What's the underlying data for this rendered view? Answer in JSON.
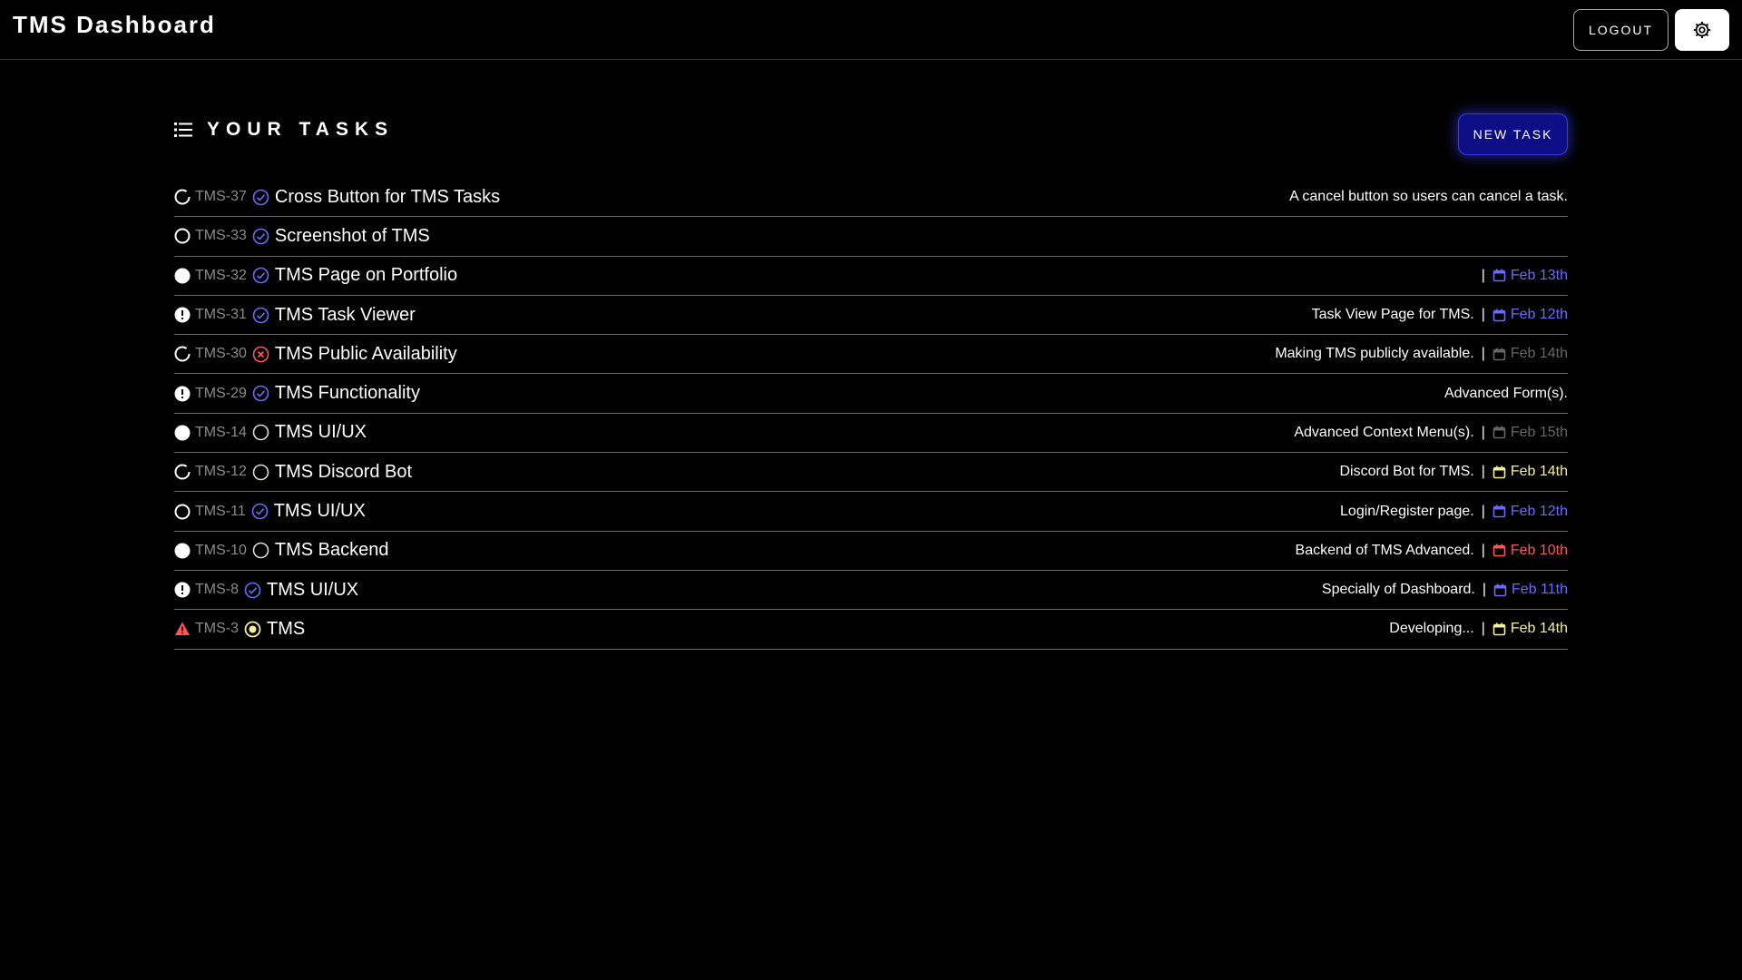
{
  "header": {
    "title": "TMS Dashboard",
    "logout_label": "LOGOUT",
    "settings_icon": "gear-icon"
  },
  "tasks_section": {
    "heading": "YOUR TASKS",
    "heading_icon": "list-icon",
    "new_task_label": "NEW TASK"
  },
  "colors": {
    "accent_blue": "#6a6aff",
    "overdue_red": "#ff5555",
    "warning_yellow": "#f5ee9a",
    "muted_gray": "#666666",
    "new_task_bg": "#0d0d85"
  },
  "tasks": [
    {
      "key": "TMS-37",
      "priority": "medium",
      "status": "done",
      "title": "Cross Button for TMS Tasks",
      "description": "A cancel button so users can cancel a task.",
      "due": "",
      "due_state": ""
    },
    {
      "key": "TMS-33",
      "priority": "low",
      "status": "done",
      "title": "Screenshot of TMS",
      "description": "",
      "due": "",
      "due_state": ""
    },
    {
      "key": "TMS-32",
      "priority": "high",
      "status": "done",
      "title": "TMS Page on Portfolio",
      "description": "",
      "due": "Feb 13th",
      "due_state": "blue"
    },
    {
      "key": "TMS-31",
      "priority": "urgent",
      "status": "done",
      "title": "TMS Task Viewer",
      "description": "Task View Page for TMS.",
      "due": "Feb 12th",
      "due_state": "blue"
    },
    {
      "key": "TMS-30",
      "priority": "medium",
      "status": "cancelled",
      "title": "TMS Public Availability",
      "description": "Making TMS publicly available.",
      "due": "Feb 14th",
      "due_state": "gray"
    },
    {
      "key": "TMS-29",
      "priority": "urgent",
      "status": "done",
      "title": "TMS Functionality",
      "description": "Advanced Form(s).",
      "due": "",
      "due_state": ""
    },
    {
      "key": "TMS-14",
      "priority": "high",
      "status": "todo",
      "title": "TMS UI/UX",
      "description": "Advanced Context Menu(s).",
      "due": "Feb 15th",
      "due_state": "gray"
    },
    {
      "key": "TMS-12",
      "priority": "medium",
      "status": "todo",
      "title": "TMS Discord Bot",
      "description": "Discord Bot for TMS.",
      "due": "Feb 14th",
      "due_state": "yellow"
    },
    {
      "key": "TMS-11",
      "priority": "low",
      "status": "done",
      "title": "TMS UI/UX",
      "description": "Login/Register page.",
      "due": "Feb 12th",
      "due_state": "blue"
    },
    {
      "key": "TMS-10",
      "priority": "high",
      "status": "todo",
      "title": "TMS Backend",
      "description": "Backend of TMS Advanced.",
      "due": "Feb 10th",
      "due_state": "red"
    },
    {
      "key": "TMS-8",
      "priority": "urgent",
      "status": "done",
      "title": "TMS UI/UX",
      "description": "Specially of Dashboard.",
      "due": "Feb 11th",
      "due_state": "blue"
    },
    {
      "key": "TMS-3",
      "priority": "critical",
      "status": "in-progress",
      "title": "TMS",
      "description": "Developing...",
      "due": "Feb 14th",
      "due_state": "yellow"
    }
  ]
}
